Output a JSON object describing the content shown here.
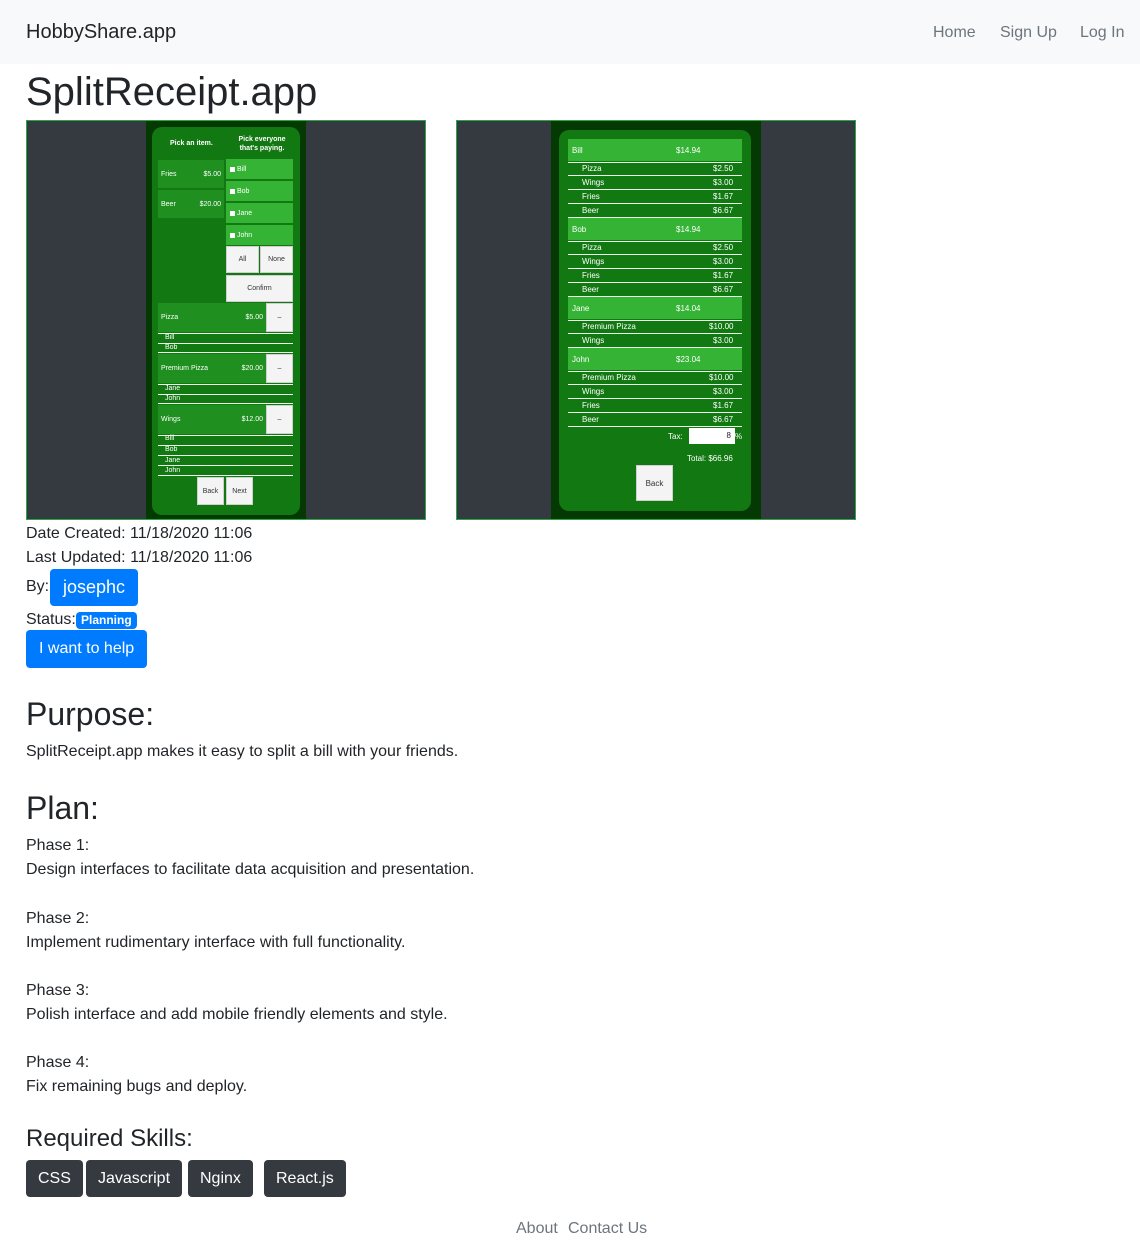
{
  "nav": {
    "brand": "HobbyShare.app",
    "links": [
      "Home",
      "Sign Up",
      "Log In"
    ]
  },
  "project": {
    "title": "SplitReceipt.app",
    "date_created": "Date Created: 11/18/2020 11:06",
    "last_updated": "Last Updated: 11/18/2020 11:06",
    "by_label": "By:",
    "author": "josephc",
    "status_label": "Status:",
    "status": "Planning",
    "help_button": "I want to help"
  },
  "screenshot1": {
    "header_left": "Pick an item.",
    "header_right": "Pick everyone that's paying.",
    "items": [
      {
        "name": "Fries",
        "price": "$5.00"
      },
      {
        "name": "Beer",
        "price": "$20.00"
      }
    ],
    "people": [
      "Bill",
      "Bob",
      "Jane",
      "John"
    ],
    "all_label": "All",
    "none_label": "None",
    "confirm_label": "Confirm",
    "assigned": [
      {
        "name": "Pizza",
        "price": "$5.00",
        "people": [
          "Bill",
          "Bob"
        ]
      },
      {
        "name": "Premium Pizza",
        "price": "$20.00",
        "people": [
          "Jane",
          "John"
        ]
      },
      {
        "name": "Wings",
        "price": "$12.00",
        "people": [
          "Bill",
          "Bob",
          "Jane",
          "John"
        ]
      }
    ],
    "remove_label": "–",
    "back_label": "Back",
    "next_label": "Next"
  },
  "screenshot2": {
    "people": [
      {
        "name": "Bill",
        "total": "$14.94",
        "items": [
          [
            "Pizza",
            "$2.50"
          ],
          [
            "Wings",
            "$3.00"
          ],
          [
            "Fries",
            "$1.67"
          ],
          [
            "Beer",
            "$6.67"
          ]
        ]
      },
      {
        "name": "Bob",
        "total": "$14.94",
        "items": [
          [
            "Pizza",
            "$2.50"
          ],
          [
            "Wings",
            "$3.00"
          ],
          [
            "Fries",
            "$1.67"
          ],
          [
            "Beer",
            "$6.67"
          ]
        ]
      },
      {
        "name": "Jane",
        "total": "$14.04",
        "items": [
          [
            "Premium Pizza",
            "$10.00"
          ],
          [
            "Wings",
            "$3.00"
          ]
        ]
      },
      {
        "name": "John",
        "total": "$23.04",
        "items": [
          [
            "Premium Pizza",
            "$10.00"
          ],
          [
            "Wings",
            "$3.00"
          ],
          [
            "Fries",
            "$1.67"
          ],
          [
            "Beer",
            "$6.67"
          ]
        ]
      }
    ],
    "tax_label": "Tax:",
    "tax_value": "8",
    "tax_unit": "%",
    "total": "Total: $66.96",
    "back_label": "Back"
  },
  "purpose": {
    "heading": "Purpose:",
    "text": "SplitReceipt.app makes it easy to split a bill with your friends."
  },
  "plan": {
    "heading": "Plan:",
    "phases": [
      {
        "label": "Phase 1:",
        "text": "Design interfaces to facilitate data acquisition and presentation."
      },
      {
        "label": "Phase 2:",
        "text": "Implement rudimentary interface with full functionality."
      },
      {
        "label": "Phase 3:",
        "text": "Polish interface and add mobile friendly elements and style."
      },
      {
        "label": "Phase 4:",
        "text": "Fix remaining bugs and deploy."
      }
    ]
  },
  "skills": {
    "heading": "Required Skills:",
    "items": [
      "CSS",
      "Javascript",
      "Nginx",
      "React.js"
    ]
  },
  "footer": {
    "links": [
      "About",
      "Contact Us"
    ]
  }
}
